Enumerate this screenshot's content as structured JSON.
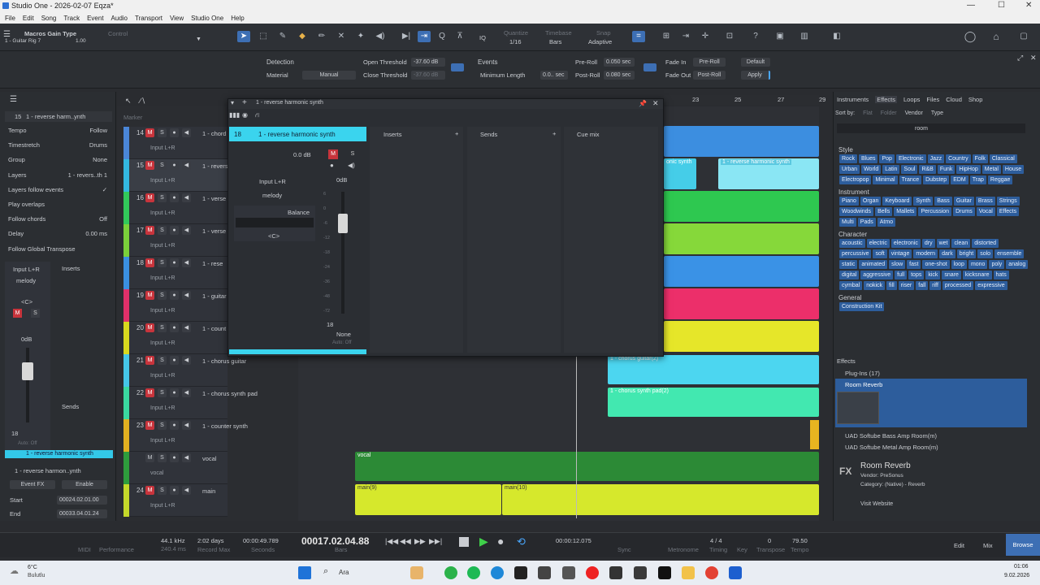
{
  "window": {
    "title": "Studio One - 2026-02-07 Eqza*",
    "min": "—",
    "max": "☐",
    "close": "✕"
  },
  "menu": [
    "File",
    "Edit",
    "Song",
    "Track",
    "Event",
    "Audio",
    "Transport",
    "View",
    "Studio One",
    "Help"
  ],
  "toolbar": {
    "preset": "Macros Gain Type",
    "preset_sub": "1 - Guitar Rig 7",
    "preset_val": "1.00",
    "control_label": "Control",
    "quantize_label": "Quantize",
    "quantize_val": "1/16",
    "timebase_label": "Timebase",
    "timebase_val": "Bars",
    "snap_label": "Snap",
    "snap_val": "Adaptive",
    "iq": "IQ"
  },
  "infobar": {
    "detection": "Detection",
    "material": "Material",
    "material_val": "Manual",
    "open_threshold": "Open Threshold",
    "open_threshold_val": "-37.60 dB",
    "close_threshold": "Close Threshold",
    "close_threshold_val": "-37.60 dB",
    "events": "Events",
    "min_length": "Minimum Length",
    "min_length_val": "0.0.. sec",
    "pre_roll": "Pre-Roll",
    "pre_roll_val": "0.050 sec",
    "post_roll": "Post-Roll",
    "post_roll_val": "0.080 sec",
    "fade_in": "Fade In",
    "fade_out": "Fade Out",
    "pre_roll_btn": "Pre-Roll",
    "post_roll_btn": "Post-Roll",
    "default_btn": "Default",
    "apply_btn": "Apply"
  },
  "inspector": {
    "track_num": "15",
    "track_name": "1 - reverse harm..ynth",
    "rows": [
      {
        "k": "Tempo",
        "v": "Follow"
      },
      {
        "k": "Timestretch",
        "v": "Drums"
      },
      {
        "k": "Group",
        "v": "None"
      },
      {
        "k": "Layers",
        "v": "1 - revers..th 1"
      },
      {
        "k": "Layers follow events",
        "v": "✓"
      },
      {
        "k": "Play overlaps",
        "v": ""
      },
      {
        "k": "Follow chords",
        "v": "Off"
      },
      {
        "k": "Delay",
        "v": "0.00 ms"
      },
      {
        "k": "Follow Global Transpose",
        "v": ""
      }
    ],
    "input": "Input L+R",
    "inserts": "Inserts",
    "channel": "melody",
    "pan": "<C>",
    "gain": "0dB",
    "sends": "Sends",
    "fader_num": "18",
    "auto": "Auto: Off",
    "ch_name": "1 - reverse harmonic synth",
    "bottom_name": "1 - reverse harmon..ynth",
    "event_fx": "Event FX",
    "enable": "Enable",
    "start_label": "Start",
    "start_val": "00024.02.01.00",
    "end_label": "End",
    "end_val": "00033.04.01.24"
  },
  "marker": "Marker",
  "tracks": [
    {
      "n": "14",
      "name": "1 - chord",
      "inp": "Input L+R",
      "color": "#4a86d8"
    },
    {
      "n": "15",
      "name": "1 - revers",
      "inp": "Input L+R",
      "color": "#33b8e0"
    },
    {
      "n": "16",
      "name": "1 - verse",
      "inp": "Input L+R",
      "color": "#32c85a"
    },
    {
      "n": "17",
      "name": "1 - verse",
      "inp": "Input L+R",
      "color": "#7ad03a"
    },
    {
      "n": "18",
      "name": "1 - rese",
      "inp": "Input L+R",
      "color": "#3a8fe0"
    },
    {
      "n": "19",
      "name": "1 - guitar",
      "inp": "Input L+R",
      "color": "#e0306a"
    },
    {
      "n": "20",
      "name": "1 - count",
      "inp": "Input L+R",
      "color": "#d8d81e"
    },
    {
      "n": "21",
      "name": "1 - chorus guitar",
      "inp": "Input L+R",
      "color": "#45c6e8"
    },
    {
      "n": "22",
      "name": "1 - chorus synth pad",
      "inp": "Input L+R",
      "color": "#3ad8a0"
    },
    {
      "n": "23",
      "name": "1 - counter synth",
      "inp": "Input L+R",
      "color": "#e2b020"
    },
    {
      "n": "",
      "name": "vocal",
      "inp": "vocal",
      "color": "#2e9c3c"
    },
    {
      "n": "24",
      "name": "main",
      "inp": "Input L+R",
      "color": "#c4d82a"
    }
  ],
  "ruler": [
    "23",
    "25",
    "27",
    "29"
  ],
  "clips": {
    "c1": "1 - reverse harmonic synth",
    "c2": "onic synth",
    "c3": "1 - chorus guitar(2)",
    "c4": "1 - chorus synth pad(2)",
    "vocal": "vocal",
    "main1": "main(9)",
    "main2": "main(10)"
  },
  "mixer": {
    "title": "1 - reverse harmonic synth",
    "ch_num": "18",
    "ch_name": "1 - reverse harmonic synth",
    "inserts": "Inserts",
    "sends": "Sends",
    "cue": "Cue mix",
    "gain": "0.0 dB",
    "input": "Input L+R",
    "channel": "melody",
    "balance": "Balance",
    "pan": "<C>",
    "fader_db": "0dB",
    "fader_num": "18",
    "none": "None",
    "auto": "Auto: Off",
    "scale": [
      "6",
      "0",
      "-6",
      "-12",
      "-18",
      "-24",
      "-36",
      "-48",
      "-72"
    ]
  },
  "browser": {
    "tabs": [
      "Instruments",
      "Effects",
      "Loops",
      "Files",
      "Cloud",
      "Shop"
    ],
    "sortby": "Sort by:",
    "sort_opts": [
      "Flat",
      "Folder",
      "Vendor",
      "Type"
    ],
    "search": "room",
    "style_title": "Style",
    "style": [
      "Rock",
      "Blues",
      "Pop",
      "Electronic",
      "Jazz",
      "Country",
      "Folk",
      "Classical",
      "Urban",
      "World",
      "Latin",
      "Soul",
      "R&B",
      "Funk",
      "HipHop",
      "Metal",
      "House",
      "Electropop",
      "Minimal",
      "Trance",
      "Dubstep",
      "EDM",
      "Trap",
      "Reggae"
    ],
    "instrument_title": "Instrument",
    "instrument": [
      "Piano",
      "Organ",
      "Keyboard",
      "Synth",
      "Bass",
      "Guitar",
      "Brass",
      "Strings",
      "Woodwinds",
      "Bells",
      "Mallets",
      "Percussion",
      "Drums",
      "Vocal",
      "Effects",
      "Multi",
      "Pads",
      "Atmo"
    ],
    "character_title": "Character",
    "character": [
      "acoustic",
      "electric",
      "electronic",
      "dry",
      "wet",
      "clean",
      "distorted",
      "percussive",
      "soft",
      "vintage",
      "modern",
      "dark",
      "bright",
      "solo",
      "ensemble",
      "static",
      "animated",
      "slow",
      "fast",
      "one-shot",
      "loop",
      "mono",
      "poly",
      "analog",
      "digital",
      "aggressive",
      "full",
      "tops",
      "kick",
      "snare",
      "kicksnare",
      "hats",
      "cymbal",
      "nokick",
      "fill",
      "riser",
      "fall",
      "riff",
      "processed",
      "expressive"
    ],
    "general_title": "General",
    "general": [
      "Construction Kit"
    ],
    "effects_title": "Effects",
    "plugins": "Plug-Ins (17)",
    "items": [
      "Room Reverb",
      "UAD Softube Bass Amp Room(m)",
      "UAD Softube Metal Amp Room(m)"
    ],
    "detail_name": "Room Reverb",
    "vendor": "Vendor:    PreSonus",
    "category": "Category:  (Native) - Reverb",
    "website": "Visit Website",
    "fx": "FX"
  },
  "transport": {
    "midi": "MIDI",
    "performance": "Performance",
    "rate": "44.1 kHz",
    "lat": "240.4 ms",
    "days": "2:02 days",
    "record_max": "Record Max",
    "time": "00:00:49.789",
    "seconds": "Seconds",
    "position": "00017.02.04.88",
    "bars": "Bars",
    "loop_time": "00:00:12.075",
    "sync": "Sync",
    "metronome": "Metronome",
    "sig": "4 / 4",
    "timing": "Timing",
    "key_val": "0",
    "key": "Key",
    "transpose": "Transpose",
    "tempo": "79.50",
    "tempo_label": "Tempo",
    "edit": "Edit",
    "mix": "Mix",
    "browse": "Browse",
    "normal": "Normal"
  },
  "taskbar": {
    "temp": "6°C",
    "weather": "Bulutlu",
    "search": "Ara",
    "time": "01:06",
    "date": "9.02.2026"
  }
}
